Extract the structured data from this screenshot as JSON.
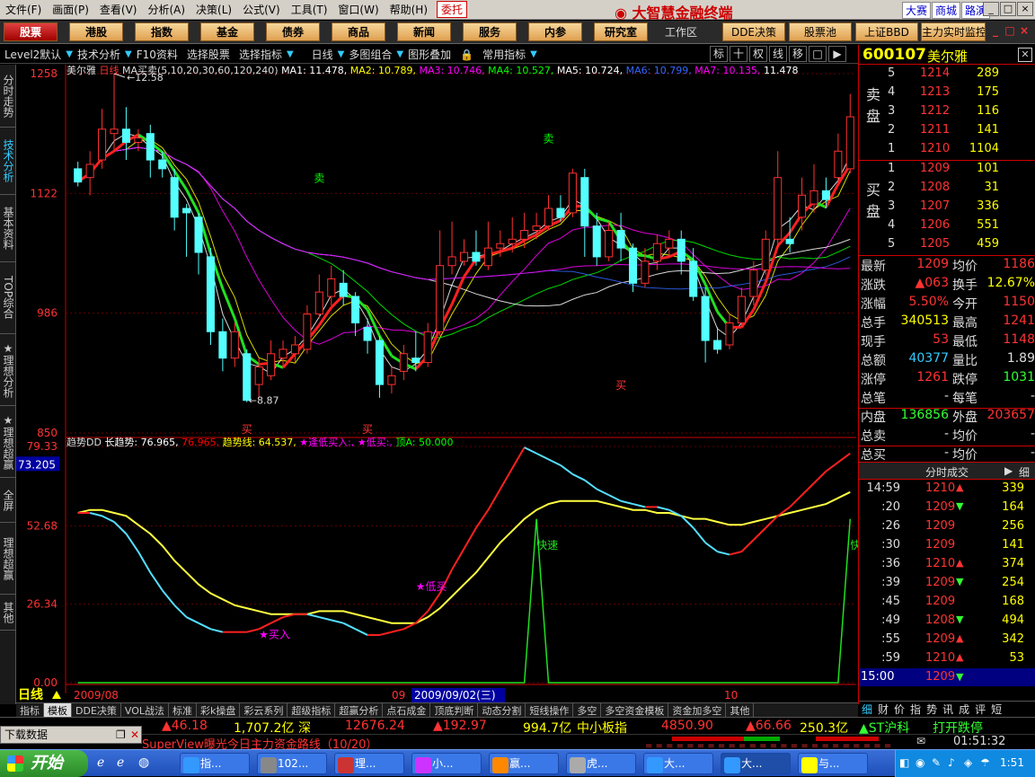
{
  "menubar": {
    "items": [
      "文件(F)",
      "画面(P)",
      "查看(V)",
      "分析(A)",
      "决策(L)",
      "公式(V)",
      "工具(T)",
      "窗口(W)",
      "帮助(H)"
    ],
    "weituo": "委托",
    "app_title": "大智慧金融终端",
    "links": [
      "大赛",
      "商城",
      "路演"
    ],
    "window_buttons": [
      "_",
      "□",
      "×"
    ]
  },
  "navbar": {
    "buttons": [
      "股票",
      "港股",
      "指数",
      "基金",
      "债券",
      "商品",
      "新闻",
      "服务",
      "内参",
      "研究室"
    ],
    "work_area": "工作区",
    "right_buttons": [
      "DDE决策",
      "股票池",
      "上证BBD",
      "主力实时监控"
    ],
    "win_buttons": [
      "_",
      "□",
      "×"
    ]
  },
  "toolbar": {
    "items": [
      "Level2默认",
      "技术分析",
      "F10资料",
      "选择股票",
      "选择指标",
      "日线",
      "多图组合",
      "图形叠加",
      "常用指标"
    ],
    "icons": [
      "标",
      "十",
      "权",
      "线",
      "移",
      "□",
      "▶"
    ]
  },
  "left_tabs": [
    "分时走势",
    "技术分析",
    "基本资料",
    "TOP综合",
    "★理想分析★",
    "★理想超赢★",
    "全屏",
    "理想超赢",
    "其他"
  ],
  "chart_data": [
    {
      "type": "candlestick",
      "title": "美尔雅",
      "period_label": "日线",
      "ma_header": "MA买卖(5,10,20,30,60,120,240)",
      "ma_labels": [
        {
          "text": "MA1: 11.478",
          "color": "#ffffff"
        },
        {
          "text": "MA2: 10.789",
          "color": "#ffff00"
        },
        {
          "text": "MA3: 10.746",
          "color": "#ff00ff"
        },
        {
          "text": "MA4: 10.527",
          "color": "#00ff00"
        },
        {
          "text": "MA5: 10.724",
          "color": "#ffffff"
        },
        {
          "text": "MA6: 10.799",
          "color": "#3366ff"
        },
        {
          "text": "MA7: 10.135",
          "color": "#ff00ff"
        },
        {
          "text": "11.478",
          "color": "#ffffff"
        }
      ],
      "y_ticks": [
        "1258",
        "1122",
        "986",
        "850"
      ],
      "ylim": [
        8.5,
        12.58
      ],
      "high_label": "12.58",
      "low_label": "8.87",
      "candles": [
        [
          11.5,
          11.35,
          11.58,
          11.3
        ],
        [
          11.4,
          11.55,
          11.7,
          11.2
        ],
        [
          11.6,
          11.95,
          12.18,
          11.5
        ],
        [
          11.9,
          11.95,
          12.58,
          11.7
        ],
        [
          11.95,
          11.8,
          12.2,
          11.6
        ],
        [
          11.8,
          11.85,
          11.95,
          11.7
        ],
        [
          11.9,
          11.6,
          12.0,
          11.4
        ],
        [
          11.6,
          11.5,
          11.7,
          11.4
        ],
        [
          11.4,
          10.95,
          11.5,
          10.8
        ],
        [
          11.05,
          11.0,
          11.1,
          10.5
        ],
        [
          10.95,
          10.55,
          11.0,
          10.3
        ],
        [
          10.5,
          9.65,
          10.6,
          9.5
        ],
        [
          9.65,
          9.35,
          9.8,
          9.2
        ],
        [
          9.35,
          9.65,
          9.75,
          9.25
        ],
        [
          9.4,
          8.87,
          9.45,
          8.85
        ],
        [
          9.05,
          9.25,
          9.35,
          8.9
        ],
        [
          9.15,
          9.4,
          9.55,
          9.1
        ],
        [
          9.35,
          9.45,
          9.55,
          9.25
        ],
        [
          9.4,
          9.5,
          9.6,
          9.3
        ],
        [
          9.45,
          9.85,
          9.95,
          9.4
        ],
        [
          9.85,
          10.1,
          10.3,
          9.8
        ],
        [
          10.05,
          10.25,
          10.4,
          9.95
        ],
        [
          10.2,
          10.05,
          10.35,
          9.95
        ],
        [
          10.05,
          9.75,
          10.1,
          9.6
        ],
        [
          9.7,
          9.55,
          9.8,
          9.4
        ],
        [
          9.55,
          9.05,
          9.6,
          8.9
        ],
        [
          9.05,
          9.15,
          9.25,
          8.95
        ],
        [
          9.2,
          9.4,
          9.5,
          9.1
        ],
        [
          9.35,
          9.3,
          9.65,
          9.2
        ],
        [
          9.3,
          9.65,
          9.75,
          9.25
        ],
        [
          9.65,
          10.4,
          10.8,
          9.6
        ],
        [
          10.4,
          10.5,
          10.9,
          10.3
        ],
        [
          10.45,
          10.55,
          10.7,
          10.4
        ],
        [
          10.55,
          10.45,
          10.8,
          10.4
        ],
        [
          10.4,
          10.6,
          10.9,
          10.35
        ],
        [
          10.6,
          10.65,
          10.8,
          10.5
        ],
        [
          10.65,
          10.7,
          10.95,
          10.55
        ],
        [
          10.7,
          10.8,
          11.0,
          10.6
        ],
        [
          10.8,
          10.85,
          11.0,
          10.7
        ],
        [
          10.85,
          11.05,
          11.2,
          10.8
        ],
        [
          11.05,
          10.95,
          11.2,
          10.9
        ],
        [
          11.0,
          11.45,
          11.5,
          10.95
        ],
        [
          11.4,
          10.85,
          11.5,
          10.5
        ],
        [
          10.85,
          10.5,
          11.0,
          10.4
        ],
        [
          10.5,
          10.8,
          10.9,
          10.45
        ],
        [
          10.8,
          10.6,
          11.0,
          10.45
        ],
        [
          10.6,
          10.2,
          10.65,
          10.1
        ],
        [
          10.2,
          10.45,
          10.6,
          10.15
        ],
        [
          10.45,
          10.65,
          10.75,
          10.35
        ],
        [
          10.6,
          10.7,
          10.8,
          10.5
        ],
        [
          10.7,
          10.45,
          10.8,
          10.3
        ],
        [
          10.45,
          10.05,
          10.6,
          10.0
        ],
        [
          10.05,
          9.55,
          10.15,
          9.3
        ],
        [
          9.55,
          9.45,
          9.7,
          9.4
        ],
        [
          9.5,
          9.75,
          9.85,
          9.45
        ],
        [
          9.75,
          10.05,
          10.15,
          9.7
        ],
        [
          10.05,
          10.35,
          10.45,
          9.95
        ],
        [
          10.35,
          10.7,
          10.8,
          10.3
        ],
        [
          10.7,
          11.4,
          11.7,
          10.6
        ],
        [
          10.7,
          10.65,
          10.95,
          10.55
        ],
        [
          10.95,
          11.2,
          11.4,
          10.8
        ],
        [
          11.1,
          11.25,
          11.55,
          11.0
        ],
        [
          11.25,
          11.15,
          11.4,
          11.05
        ],
        [
          11.4,
          11.7,
          11.9,
          11.35
        ],
        [
          11.5,
          12.09,
          12.35,
          11.45
        ]
      ],
      "annotations": [
        "卖",
        "卖",
        "买",
        "买",
        "买"
      ]
    },
    {
      "type": "line",
      "indicator_name": "趋势DD",
      "value_labels": [
        {
          "text": "长趋势: 76.965",
          "color": "#ffffff"
        },
        {
          "text": "76.965",
          "color": "#ff0000"
        },
        {
          "text": "趋势线: 64.537",
          "color": "#ffff00"
        },
        {
          "text": "★逢低买入:",
          "color": "#ff00ff"
        },
        {
          "text": "★低买:",
          "color": "#ff00ff"
        },
        {
          "text": "顶A: 50.000",
          "color": "#00ff00"
        }
      ],
      "current_value": "73.205",
      "y_ticks": [
        "79.33",
        "52.68",
        "26.34",
        "0.00"
      ],
      "ylim": [
        0,
        79.33
      ],
      "x_labels": [
        "日线",
        "2009/08",
        "09",
        "2009/09/02(三)",
        "10"
      ],
      "annotations": [
        "★买入",
        "★低买",
        "快速",
        "快速"
      ],
      "long_trend": [
        57,
        57,
        56,
        54,
        50,
        44,
        37,
        31,
        26,
        22,
        20,
        18,
        17,
        17,
        17,
        18,
        20,
        22,
        23,
        23,
        22,
        21,
        20,
        18,
        16,
        16,
        17,
        18,
        20,
        24,
        30,
        38,
        45,
        52,
        58,
        65,
        72,
        79,
        77,
        75,
        73,
        70,
        68,
        65,
        63,
        61,
        60,
        59,
        59,
        58,
        56,
        52,
        47,
        44,
        43,
        44,
        48,
        52,
        56,
        59,
        63,
        67,
        71,
        74,
        77
      ],
      "trend_line": [
        57,
        58,
        58,
        57,
        56,
        53,
        50,
        46,
        41,
        37,
        33,
        30,
        28,
        26,
        25,
        24,
        23,
        23,
        23,
        23,
        24,
        24,
        24,
        23,
        22,
        21,
        20,
        20,
        20,
        22,
        25,
        29,
        33,
        37,
        42,
        47,
        51,
        55,
        58,
        60,
        61,
        61,
        61,
        61,
        60,
        59,
        58,
        58,
        57,
        57,
        56,
        55,
        55,
        54,
        53,
        53,
        54,
        55,
        56,
        57,
        58,
        59,
        60,
        62,
        64
      ],
      "fast_signal": [
        0,
        0,
        0,
        0,
        0,
        0,
        0,
        0,
        0,
        0,
        0,
        0,
        0,
        0,
        0,
        0,
        0,
        0,
        0,
        0,
        0,
        0,
        0,
        0,
        0,
        0,
        0,
        0,
        0,
        0,
        0,
        0,
        0,
        0,
        0,
        0,
        0,
        0,
        55,
        0,
        0,
        0,
        0,
        0,
        0,
        0,
        0,
        0,
        0,
        0,
        0,
        0,
        0,
        0,
        0,
        0,
        0,
        0,
        0,
        0,
        0,
        0,
        0,
        0,
        55
      ]
    }
  ],
  "right_panel": {
    "code": "600107",
    "name": "美尔雅",
    "sell_label": [
      "卖",
      "盘"
    ],
    "buy_label": [
      "买",
      "盘"
    ],
    "sells": [
      {
        "level": "5",
        "price": "1214",
        "vol": "289"
      },
      {
        "level": "4",
        "price": "1213",
        "vol": "175"
      },
      {
        "level": "3",
        "price": "1212",
        "vol": "116"
      },
      {
        "level": "2",
        "price": "1211",
        "vol": "141"
      },
      {
        "level": "1",
        "price": "1210",
        "vol": "1104"
      }
    ],
    "buys": [
      {
        "level": "1",
        "price": "1209",
        "vol": "101"
      },
      {
        "level": "2",
        "price": "1208",
        "vol": "31"
      },
      {
        "level": "3",
        "price": "1207",
        "vol": "336"
      },
      {
        "level": "4",
        "price": "1206",
        "vol": "551"
      },
      {
        "level": "5",
        "price": "1205",
        "vol": "459"
      }
    ],
    "quotes": [
      {
        "k": "最新",
        "v": "1209",
        "vc": "red",
        "k2": "均价",
        "v2": "1186",
        "v2c": "red"
      },
      {
        "k": "涨跌",
        "v": "▲063",
        "vc": "red",
        "k2": "换手",
        "v2": "12.67%",
        "v2c": "yel"
      },
      {
        "k": "涨幅",
        "v": "5.50%",
        "vc": "red",
        "k2": "今开",
        "v2": "1150",
        "v2c": "red"
      },
      {
        "k": "总手",
        "v": "340513",
        "vc": "yel",
        "k2": "最高",
        "v2": "1241",
        "v2c": "red"
      },
      {
        "k": "现手",
        "v": "53",
        "vc": "red",
        "k2": "最低",
        "v2": "1148",
        "v2c": "red"
      },
      {
        "k": "总额",
        "v": "40377",
        "vc": "cyn",
        "k2": "量比",
        "v2": "1.89",
        "v2c": "wht"
      },
      {
        "k": "涨停",
        "v": "1261",
        "vc": "red",
        "k2": "跌停",
        "v2": "1031",
        "v2c": "grn"
      },
      {
        "k": "总笔",
        "v": "-",
        "vc": "wht",
        "k2": "每笔",
        "v2": "-",
        "v2c": "wht"
      },
      {
        "k": "内盘",
        "v": "136856",
        "vc": "grn",
        "k2": "外盘",
        "v2": "203657",
        "v2c": "red"
      },
      {
        "k": "总卖",
        "v": "-",
        "vc": "wht",
        "k2": "均价",
        "v2": "-",
        "v2c": "wht"
      },
      {
        "k": "总买",
        "v": "-",
        "vc": "wht",
        "k2": "均价",
        "v2": "-",
        "v2c": "wht"
      }
    ],
    "tick_header": "分时成交",
    "tick_tab": "细",
    "ticks": [
      {
        "t": "14:59",
        "p": "1210",
        "a": "up",
        "v": "339"
      },
      {
        "t": ":20",
        "p": "1209",
        "a": "down",
        "v": "164"
      },
      {
        "t": ":26",
        "p": "1209",
        "a": "",
        "v": "256"
      },
      {
        "t": ":30",
        "p": "1209",
        "a": "",
        "v": "141"
      },
      {
        "t": ":36",
        "p": "1210",
        "a": "up",
        "v": "374"
      },
      {
        "t": ":39",
        "p": "1209",
        "a": "down",
        "v": "254"
      },
      {
        "t": ":45",
        "p": "1209",
        "a": "",
        "v": "168"
      },
      {
        "t": ":49",
        "p": "1208",
        "a": "down",
        "v": "494"
      },
      {
        "t": ":55",
        "p": "1209",
        "a": "up",
        "v": "342"
      },
      {
        "t": ":59",
        "p": "1210",
        "a": "up",
        "v": "53"
      }
    ],
    "last_tick": {
      "t": "15:00",
      "p": "1209",
      "a": "down"
    },
    "tabs": [
      "细",
      "财",
      "价",
      "指",
      "势",
      "讯",
      "成",
      "评",
      "短"
    ]
  },
  "bottom_tabs": [
    "指标",
    "模板",
    "DDE决策",
    "VOL战法",
    "标准",
    "彩k操盘",
    "彩云系列",
    "超级指标",
    "超赢分析",
    "点石成金",
    "顶底判断",
    "动态分割",
    "短线操作",
    "多空",
    "多空资金模板",
    "资金加多空",
    "其他"
  ],
  "index_bar": [
    {
      "text": "▲46.18",
      "c": "red"
    },
    {
      "text": "1,707.2亿",
      "c": "yel"
    },
    {
      "text": "深",
      "c": "yel"
    },
    {
      "text": "12676.24",
      "c": "red"
    },
    {
      "text": "▲192.97",
      "c": "red"
    },
    {
      "text": "994.7亿",
      "c": "yel"
    },
    {
      "text": "中小板指",
      "c": "yel"
    },
    {
      "text": "4850.90",
      "c": "red"
    },
    {
      "text": "▲66.66",
      "c": "red"
    },
    {
      "text": "250.3亿",
      "c": "yel"
    },
    {
      "text": "▲ST沪科",
      "c": "grn"
    },
    {
      "text": "打开跌停",
      "c": "grn"
    }
  ],
  "download_label": "下载数据",
  "super_view": "SuperView曝光今日主力资金路线（10/20）",
  "status_clock": "01:51:32",
  "taskbar": {
    "start": "开始",
    "tasks": [
      "指...",
      "102...",
      "理...",
      "小...",
      "赢...",
      "虎...",
      "大...",
      "大...",
      "与..."
    ],
    "clock": "1:51"
  }
}
